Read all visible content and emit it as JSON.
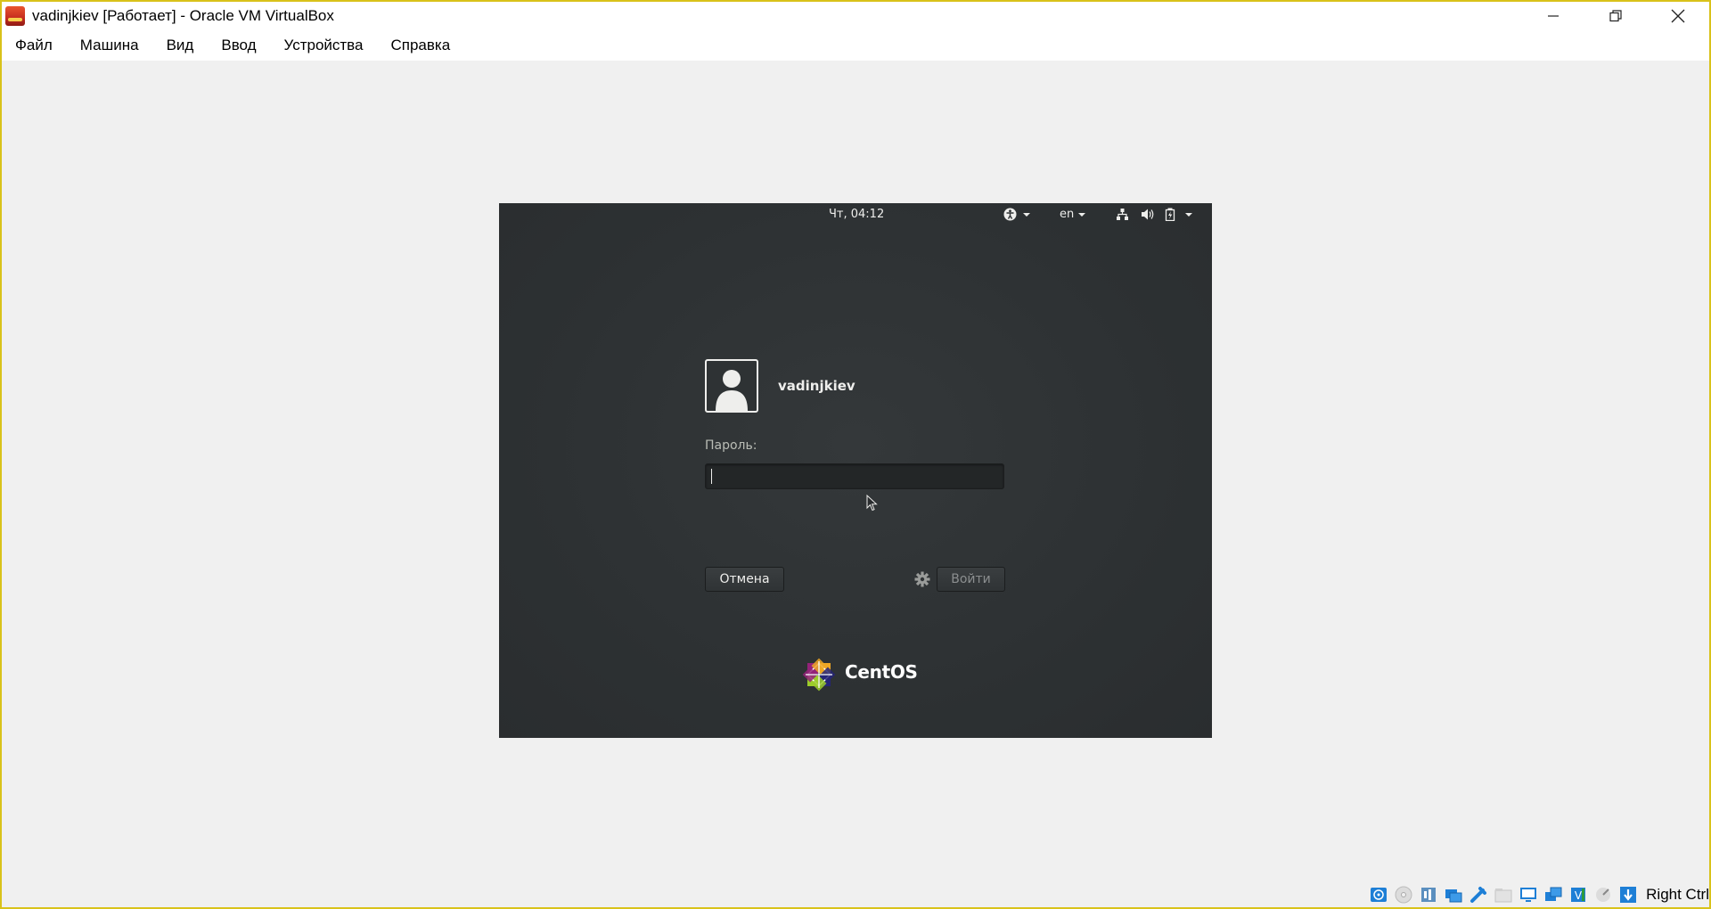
{
  "window": {
    "title": "vadinjkiev [Работает] - Oracle VM VirtualBox"
  },
  "menu": {
    "items": [
      "Файл",
      "Машина",
      "Вид",
      "Ввод",
      "Устройства",
      "Справка"
    ]
  },
  "vm": {
    "topbar": {
      "clock": "Чт, 04:12",
      "language": "en"
    },
    "login": {
      "username": "vadinjkiev",
      "password_label": "Пароль:",
      "password_value": "",
      "cancel_label": "Отмена",
      "login_label": "Войти"
    },
    "brand": "CentOS"
  },
  "statusbar": {
    "host_key": "Right Ctrl",
    "icons": [
      "hard-disk-icon",
      "optical-drive-icon",
      "audio-icon",
      "network-icon",
      "usb-icon",
      "shared-folders-icon",
      "display-icon",
      "video-capture-icon",
      "drag-drop-icon",
      "cpu-icon",
      "mouse-integration-icon",
      "keyboard-capture-icon"
    ]
  },
  "colors": {
    "window_border": "#d9c21a",
    "vm_background": "#2f3335",
    "accent_text": "#eeeeec"
  }
}
